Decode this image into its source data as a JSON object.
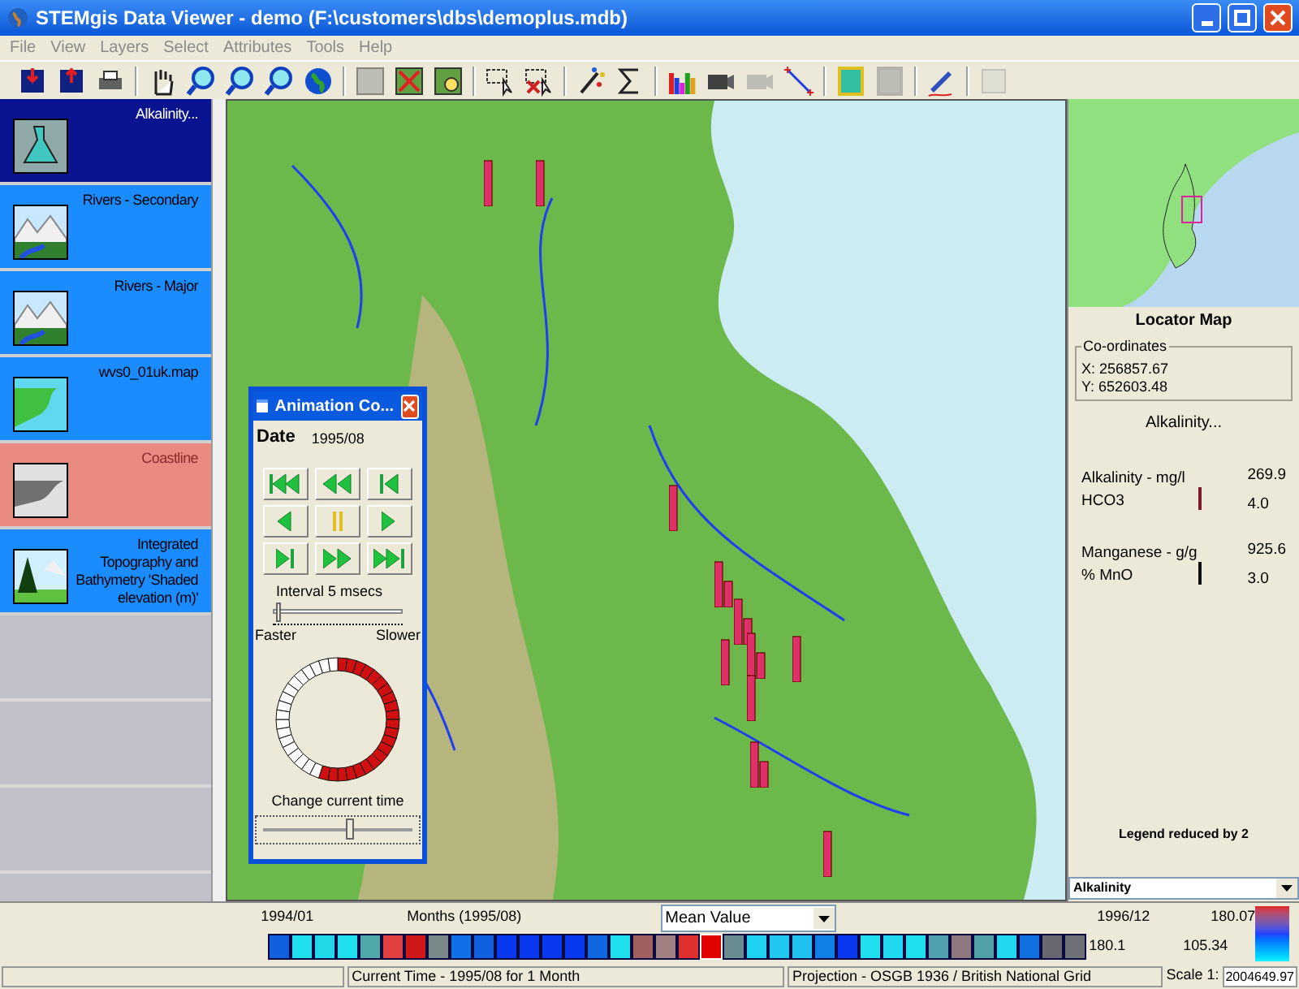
{
  "window": {
    "title": "STEMgis Data Viewer - demo (F:\\customers\\dbs\\demoplus.mdb)"
  },
  "menu": [
    "File",
    "View",
    "Layers",
    "Select",
    "Attributes",
    "Tools",
    "Help"
  ],
  "toolbar": [
    {
      "kind": "save",
      "disabled": false
    },
    {
      "kind": "export",
      "disabled": false
    },
    {
      "kind": "print",
      "disabled": false
    },
    {
      "kind": "sep"
    },
    {
      "kind": "hand",
      "disabled": false
    },
    {
      "kind": "zoom-in",
      "disabled": false
    },
    {
      "kind": "zoom-out",
      "disabled": false
    },
    {
      "kind": "zoom-extent",
      "disabled": false
    },
    {
      "kind": "globe",
      "disabled": false
    },
    {
      "kind": "sep"
    },
    {
      "kind": "map",
      "disabled": true
    },
    {
      "kind": "map-remove",
      "disabled": false
    },
    {
      "kind": "map-find",
      "disabled": false
    },
    {
      "kind": "sep"
    },
    {
      "kind": "select",
      "disabled": false
    },
    {
      "kind": "deselect",
      "disabled": false
    },
    {
      "kind": "sep"
    },
    {
      "kind": "wand",
      "disabled": false
    },
    {
      "kind": "sigma",
      "disabled": false
    },
    {
      "kind": "sep"
    },
    {
      "kind": "chart",
      "disabled": false
    },
    {
      "kind": "camera",
      "disabled": false
    },
    {
      "kind": "camera",
      "disabled": true
    },
    {
      "kind": "line",
      "disabled": false
    },
    {
      "kind": "sep"
    },
    {
      "kind": "raster",
      "disabled": false
    },
    {
      "kind": "raster",
      "disabled": true
    },
    {
      "kind": "sep"
    },
    {
      "kind": "pen",
      "disabled": false
    },
    {
      "kind": "sep"
    },
    {
      "kind": "report",
      "disabled": true
    }
  ],
  "layers": [
    {
      "name": "Alkalinity...",
      "kind": "flask",
      "selected": true,
      "disabled": false
    },
    {
      "name": "Rivers - Secondary",
      "kind": "mountain",
      "selected": false,
      "disabled": false
    },
    {
      "name": "Rivers - Major",
      "kind": "mountain",
      "selected": false,
      "disabled": false
    },
    {
      "name": "wvs0_01uk.map",
      "kind": "land",
      "selected": false,
      "disabled": false
    },
    {
      "name": "Coastline",
      "kind": "coast",
      "selected": false,
      "disabled": true
    },
    {
      "name": "Integrated Topography and Bathymetry 'Shaded elevation (m)'",
      "kind": "tree",
      "selected": false,
      "disabled": false
    }
  ],
  "animation": {
    "title": "Animation Co...",
    "date_label": "Date",
    "date": "1995/08",
    "interval": "Interval 5 msecs",
    "speed": {
      "level": 0.02
    },
    "faster": "Faster",
    "slower": "Slower",
    "progress": {
      "level": 0.53
    },
    "change_label": "Change current time",
    "time": {
      "level": 0.55
    }
  },
  "locator": {
    "title": "Locator Map",
    "coords_label": "Co-ordinates",
    "x": "X: 256857.67",
    "y": "Y: 652603.48"
  },
  "legend": {
    "title": "Alkalinity...",
    "items": [
      {
        "label": "Alkalinity - mg/l",
        "unit": "HCO3",
        "max": "269.9",
        "min": "4.0",
        "color": "#7a1c2c"
      },
      {
        "label": "Manganese - g/g",
        "unit": "% MnO",
        "max": "925.6",
        "min": "3.0",
        "color": "#111111"
      }
    ],
    "note": "Legend reduced by 2",
    "layer_select": "Alkalinity"
  },
  "timeline": {
    "start": "1994/01",
    "label": "Months (1995/08)",
    "statistic": "Mean Value",
    "end": "1996/12",
    "scale_max": "180.07",
    "scale_min": "105.34",
    "current_value": "180.1",
    "cells": [
      {
        "color": "#1060e0",
        "selected": false
      },
      {
        "color": "#20e0f0",
        "selected": false
      },
      {
        "color": "#20d8e8",
        "selected": false
      },
      {
        "color": "#20e0f0",
        "selected": false
      },
      {
        "color": "#50a8a8",
        "selected": false
      },
      {
        "color": "#e04040",
        "selected": false
      },
      {
        "color": "#d01818",
        "selected": false
      },
      {
        "color": "#788888",
        "selected": false
      },
      {
        "color": "#1070e8",
        "selected": false
      },
      {
        "color": "#1060e0",
        "selected": false
      },
      {
        "color": "#0838f0",
        "selected": false
      },
      {
        "color": "#0838f0",
        "selected": false
      },
      {
        "color": "#0838f0",
        "selected": false
      },
      {
        "color": "#0838f0",
        "selected": false
      },
      {
        "color": "#1068e0",
        "selected": false
      },
      {
        "color": "#20e0f0",
        "selected": false
      },
      {
        "color": "#a06060",
        "selected": false
      },
      {
        "color": "#a08080",
        "selected": false
      },
      {
        "color": "#e03030",
        "selected": false
      },
      {
        "color": "#e00000",
        "selected": true
      },
      {
        "color": "#688c90",
        "selected": false
      },
      {
        "color": "#20d0f0",
        "selected": false
      },
      {
        "color": "#20c8f0",
        "selected": false
      },
      {
        "color": "#20c0f0",
        "selected": false
      },
      {
        "color": "#1080e8",
        "selected": false
      },
      {
        "color": "#0838f0",
        "selected": false
      },
      {
        "color": "#20e0f0",
        "selected": false
      },
      {
        "color": "#20d8f0",
        "selected": false
      },
      {
        "color": "#20e0f0",
        "selected": false
      },
      {
        "color": "#50a0b0",
        "selected": false
      },
      {
        "color": "#907880",
        "selected": false
      },
      {
        "color": "#50a0a8",
        "selected": false
      },
      {
        "color": "#20d8f0",
        "selected": false
      },
      {
        "color": "#1070e0",
        "selected": false
      },
      {
        "color": "#686870",
        "selected": false
      },
      {
        "color": "#707078",
        "selected": false
      }
    ]
  },
  "status": {
    "current": "Current Time - 1995/08 for 1 Month",
    "projection": "Projection - OSGB 1936 / British National Grid",
    "scale_label": "Scale 1:",
    "scale": "2004649.97"
  }
}
